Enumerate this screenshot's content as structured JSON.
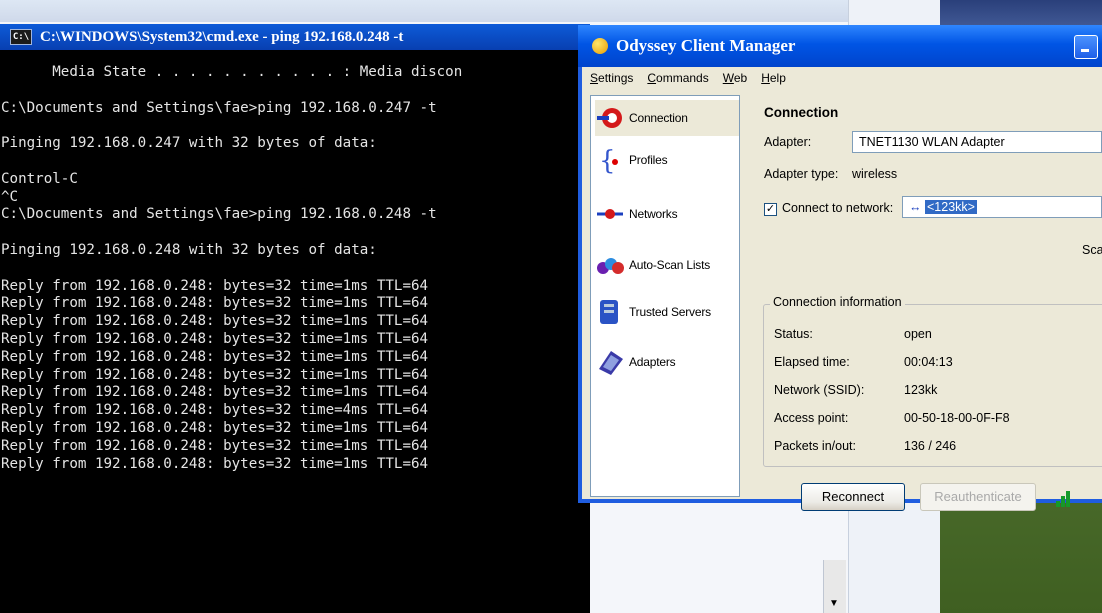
{
  "cmd": {
    "title": "C:\\WINDOWS\\System32\\cmd.exe - ping 192.168.0.248 -t",
    "icon_label": "C:\\",
    "lines": [
      "      Media State . . . . . . . . . . . : Media discon",
      "",
      "C:\\Documents and Settings\\fae>ping 192.168.0.247 -t",
      "",
      "Pinging 192.168.0.247 with 32 bytes of data:",
      "",
      "Control-C",
      "^C",
      "C:\\Documents and Settings\\fae>ping 192.168.0.248 -t",
      "",
      "Pinging 192.168.0.248 with 32 bytes of data:",
      "",
      "Reply from 192.168.0.248: bytes=32 time=1ms TTL=64",
      "Reply from 192.168.0.248: bytes=32 time=1ms TTL=64",
      "Reply from 192.168.0.248: bytes=32 time=1ms TTL=64",
      "Reply from 192.168.0.248: bytes=32 time=1ms TTL=64",
      "Reply from 192.168.0.248: bytes=32 time=1ms TTL=64",
      "Reply from 192.168.0.248: bytes=32 time=1ms TTL=64",
      "Reply from 192.168.0.248: bytes=32 time=1ms TTL=64",
      "Reply from 192.168.0.248: bytes=32 time=4ms TTL=64",
      "Reply from 192.168.0.248: bytes=32 time=1ms TTL=64",
      "Reply from 192.168.0.248: bytes=32 time=1ms TTL=64",
      "Reply from 192.168.0.248: bytes=32 time=1ms TTL=64"
    ]
  },
  "odyssey": {
    "title": "Odyssey Client Manager",
    "menu": [
      "Settings",
      "Commands",
      "Web",
      "Help"
    ],
    "nav": [
      {
        "label": "Connection",
        "icon": "connection-icon"
      },
      {
        "label": "Profiles",
        "icon": "profiles-icon"
      },
      {
        "label": "Networks",
        "icon": "networks-icon"
      },
      {
        "label": "Auto-Scan Lists",
        "icon": "auto-scan-icon"
      },
      {
        "label": "Trusted Servers",
        "icon": "trusted-servers-icon"
      },
      {
        "label": "Adapters",
        "icon": "adapters-icon"
      }
    ],
    "panel": {
      "heading": "Connection",
      "adapter_label": "Adapter:",
      "adapter_value": "TNET1130 WLAN Adapter",
      "adapter_type_label": "Adapter type:",
      "adapter_type_value": "wireless",
      "connect_label": "Connect to network:",
      "network_value": "<123kk>",
      "scan_label": "Sca",
      "info_title": "Connection information",
      "status_label": "Status:",
      "status_value": "open",
      "elapsed_label": "Elapsed time:",
      "elapsed_value": "00:04:13",
      "ssid_label": "Network (SSID):",
      "ssid_value": "123kk",
      "ap_label": "Access point:",
      "ap_value": "00-50-18-00-0F-F8",
      "packets_label": "Packets in/out:",
      "packets_value": "136 / 246",
      "reconnect": "Reconnect",
      "reauth": "Reauthenticate"
    }
  }
}
